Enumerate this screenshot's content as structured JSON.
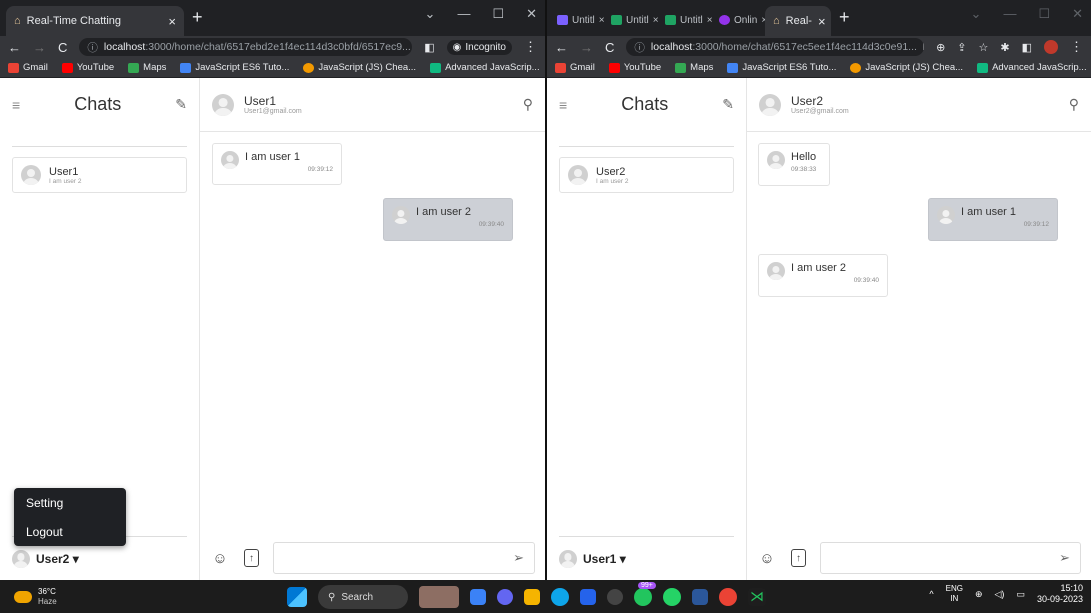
{
  "window1": {
    "active_tab": {
      "title": "Real-Time Chatting",
      "close": "×"
    },
    "new_tab": "+",
    "window_controls": [
      "⌄",
      "—",
      "☐",
      "✕"
    ],
    "url": {
      "host": "localhost",
      "rest": ":3000/home/chat/6517ebd2e1f4ec114d3c0bfd/6517ec9..."
    },
    "incognito_label": "Incognito",
    "bookmarks": [
      "Gmail",
      "YouTube",
      "Maps",
      "JavaScript ES6 Tuto...",
      "JavaScript (JS) Chea...",
      "Advanced JavaScrip..."
    ],
    "bookmarks_more": "»"
  },
  "window2": {
    "tabs": [
      "Untitl",
      "Untitl",
      "Untitl",
      "Onlin",
      "Real-"
    ],
    "new_tab": "+",
    "window_controls": [
      "⌄",
      "—",
      "☐",
      "✕"
    ],
    "url": {
      "host": "localhost",
      "rest": ":3000/home/chat/6517ec5ee1f4ec114d3c0e91..."
    },
    "bookmarks": [
      "Gmail",
      "YouTube",
      "Maps",
      "JavaScript ES6 Tuto...",
      "JavaScript (JS) Chea...",
      "Advanced JavaScrip..."
    ],
    "bookmarks_more": "»"
  },
  "app1": {
    "sidebar_title": "Chats",
    "chat_list": [
      {
        "name": "User1",
        "preview": "I am user 2"
      }
    ],
    "current_user": "User2 ▾",
    "menu_items": [
      "Setting",
      "Logout"
    ],
    "header": {
      "name": "User1",
      "email": "User1@gmail.com"
    },
    "messages": [
      {
        "text": "I am user 1",
        "time": "09:39:12",
        "outgoing": false
      },
      {
        "text": "I am user 2",
        "time": "09:39:40",
        "outgoing": true
      }
    ]
  },
  "app2": {
    "sidebar_title": "Chats",
    "chat_list": [
      {
        "name": "User2",
        "preview": "I am user 2"
      }
    ],
    "current_user": "User1 ▾",
    "header": {
      "name": "User2",
      "email": "User2@gmail.com"
    },
    "messages": [
      {
        "text": "Hello",
        "time": "09:38:33",
        "outgoing": false
      },
      {
        "text": "I am user 1",
        "time": "09:39:12",
        "outgoing": true
      },
      {
        "text": "I am user 2",
        "time": "09:39:40",
        "outgoing": false
      }
    ]
  },
  "taskbar": {
    "temperature": "36°C",
    "weather": "Haze",
    "search": "Search",
    "badge": "99+",
    "lang": "ENG",
    "region": "IN",
    "time": "15:10",
    "date": "30-09-2023"
  },
  "colors": {
    "outgoing_bubble": "#cdd0d6",
    "chrome_dark": "#35363a"
  }
}
